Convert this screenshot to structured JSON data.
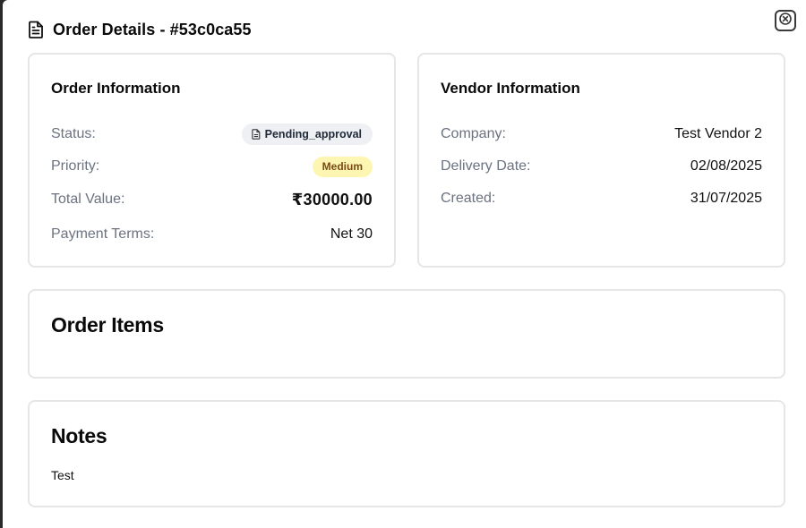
{
  "header": {
    "title": "Order Details - #53c0ca55",
    "icon": "document-icon",
    "close_icon": "close-icon"
  },
  "order_info": {
    "title": "Order Information",
    "status": {
      "label": "Status:",
      "value": "Pending_approval",
      "icon": "document-icon"
    },
    "priority": {
      "label": "Priority:",
      "value": "Medium",
      "color": "#fdf6b2"
    },
    "total_value": {
      "label": "Total Value:",
      "value": "₹30000.00"
    },
    "payment_terms": {
      "label": "Payment Terms:",
      "value": "Net 30"
    }
  },
  "vendor_info": {
    "title": "Vendor Information",
    "company": {
      "label": "Company:",
      "value": "Test Vendor 2"
    },
    "delivery_date": {
      "label": "Delivery Date:",
      "value": "02/08/2025"
    },
    "created": {
      "label": "Created:",
      "value": "31/07/2025"
    }
  },
  "order_items": {
    "title": "Order Items"
  },
  "notes": {
    "title": "Notes",
    "text": "Test"
  }
}
